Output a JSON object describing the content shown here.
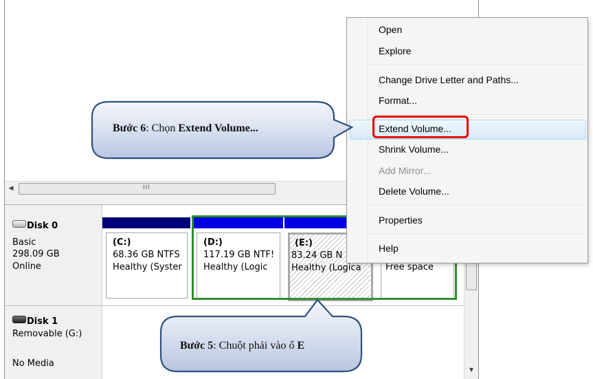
{
  "disks": [
    {
      "name": "Disk 0",
      "type": "Basic",
      "size": "298.09 GB",
      "status": "Online",
      "icon": "hard-disk-icon",
      "partitions": [
        {
          "letter": "(C:)",
          "size": "68.36 GB NTFS",
          "status": "Healthy (Syster",
          "bar_color": "#00007b"
        },
        {
          "letter": "(D:)",
          "size": "117.19 GB NTF!",
          "status": "Healthy (Logic",
          "bar_color": "#0000e6"
        },
        {
          "letter": "(E:)",
          "size": "83.24 GB N",
          "status": "Healthy (Logica",
          "bar_color": "#0000e6"
        },
        {
          "letter": "",
          "size": "Free space",
          "status": "",
          "bar_color": "#2f8f2f"
        }
      ]
    },
    {
      "name": "Disk 1",
      "type": "Removable (G:)",
      "status": "No Media",
      "icon": "removable-disk-icon"
    }
  ],
  "scrollbar": {
    "grip": "III"
  },
  "context_menu": {
    "items": [
      {
        "label": "Open",
        "enabled": true
      },
      {
        "label": "Explore",
        "enabled": true
      },
      {
        "label": "Change Drive Letter and Paths...",
        "enabled": true
      },
      {
        "label": "Format...",
        "enabled": true
      },
      {
        "label": "Extend Volume...",
        "enabled": true,
        "highlighted": true
      },
      {
        "label": "Shrink Volume...",
        "enabled": true
      },
      {
        "label": "Add Mirror...",
        "enabled": false
      },
      {
        "label": "Delete Volume...",
        "enabled": true
      },
      {
        "label": "Properties",
        "enabled": true
      },
      {
        "label": "Help",
        "enabled": true
      }
    ]
  },
  "callouts": {
    "step6": {
      "prefix": "Bước 6",
      "middle": ": Chọn ",
      "emphasis": "Extend Volume..."
    },
    "step5": {
      "prefix": "Bước 5",
      "middle": ": Chuột phải vào ổ ",
      "emphasis": "E"
    }
  },
  "colors": {
    "selection_border": "#2f8f2f",
    "highlight_box": "#e30000",
    "callout_fill": "#d3dcec",
    "callout_border": "#2f4f7f"
  }
}
